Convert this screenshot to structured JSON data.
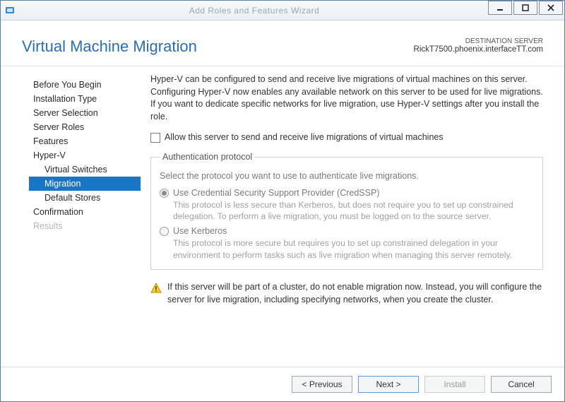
{
  "window": {
    "title": "Add Roles and Features Wizard"
  },
  "header": {
    "title": "Virtual Machine Migration",
    "destination_label": "DESTINATION SERVER",
    "destination_server": "RickT7500.phoenix.interfaceTT.com"
  },
  "sidebar": {
    "items": [
      {
        "label": "Before You Begin",
        "sub": false,
        "sel": false,
        "dis": false
      },
      {
        "label": "Installation Type",
        "sub": false,
        "sel": false,
        "dis": false
      },
      {
        "label": "Server Selection",
        "sub": false,
        "sel": false,
        "dis": false
      },
      {
        "label": "Server Roles",
        "sub": false,
        "sel": false,
        "dis": false
      },
      {
        "label": "Features",
        "sub": false,
        "sel": false,
        "dis": false
      },
      {
        "label": "Hyper-V",
        "sub": false,
        "sel": false,
        "dis": false
      },
      {
        "label": "Virtual Switches",
        "sub": true,
        "sel": false,
        "dis": false
      },
      {
        "label": "Migration",
        "sub": true,
        "sel": true,
        "dis": false
      },
      {
        "label": "Default Stores",
        "sub": true,
        "sel": false,
        "dis": false
      },
      {
        "label": "Confirmation",
        "sub": false,
        "sel": false,
        "dis": false
      },
      {
        "label": "Results",
        "sub": false,
        "sel": false,
        "dis": true
      }
    ]
  },
  "content": {
    "intro": "Hyper-V can be configured to send and receive live migrations of virtual machines on this server. Configuring Hyper-V now enables any available network on this server to be used for live migrations. If you want to dedicate specific networks for live migration, use Hyper-V settings after you install the role.",
    "checkbox": {
      "label": "Allow this server to send and receive live migrations of virtual machines",
      "checked": false
    },
    "auth_group": {
      "legend": "Authentication protocol",
      "description": "Select the protocol you want to use to authenticate live migrations.",
      "options": [
        {
          "title": "Use Credential Security Support Provider (CredSSP)",
          "desc": "This protocol is less secure than Kerberos, but does not require you to set up constrained delegation. To perform a live migration, you must be logged on to the source server.",
          "selected": true
        },
        {
          "title": "Use Kerberos",
          "desc": "This protocol is more secure but requires you to set up constrained delegation in your environment to perform tasks such as live migration when managing this server remotely.",
          "selected": false
        }
      ]
    },
    "warning": "If this server will be part of a cluster, do not enable migration now. Instead, you will configure the server for live migration, including specifying networks, when you create the cluster."
  },
  "footer": {
    "previous": "< Previous",
    "next": "Next >",
    "install": "Install",
    "cancel": "Cancel"
  }
}
